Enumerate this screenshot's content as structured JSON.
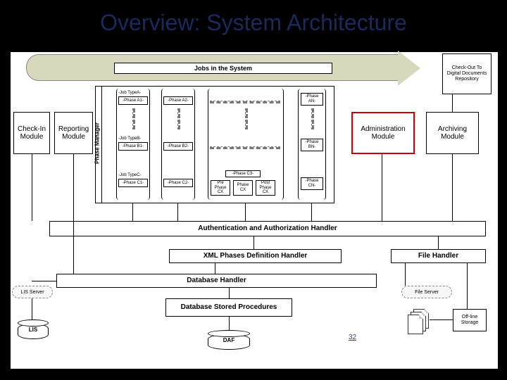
{
  "title": "Overview: System Architecture",
  "banner": {
    "jobs": "Jobs in the System"
  },
  "modules": {
    "checkin": "Check-In\nModule",
    "reporting": "Reporting\nModule",
    "phase_mgr": "Phase Manager",
    "admin": "Administration\nModule",
    "archiving": "Archiving\nModule",
    "checkout": "Check-Out\nTo\nDigital\nDocuments\nRepository"
  },
  "jobtypes": {
    "a": "-Job TypeA-",
    "b": "-Job TypeB-",
    "c": "-Job TypeC-"
  },
  "phases": {
    "a1": "-Phase A1-",
    "a2": "-Phase A2-",
    "an": "-Phase\nAN-",
    "b1": "-Phase B1-",
    "b2": "-Phase B2-",
    "bn": "-Phase\nBN-",
    "c1": "-Phase C1-",
    "c2": "-Phase C2-",
    "c3": "-Phase C3-",
    "cn": "-Phase\nCN-",
    "pre": "Pre\nPhase\nCX",
    "cx": "Phase\nCX",
    "post": "Post\nPhase\nCX"
  },
  "handlers": {
    "auth": "Authentication and Authorization  Handler",
    "xml": "XML Phases Definition Handler",
    "file": "File Handler",
    "db": "Database Handler",
    "sp": "Database\nStored Procedures"
  },
  "servers": {
    "lis": "LIS Server",
    "liscore": "LIS",
    "fileserver": "File Server",
    "offline": "Off-line\nStorage",
    "daf": "DAF"
  },
  "slide_number": "32"
}
